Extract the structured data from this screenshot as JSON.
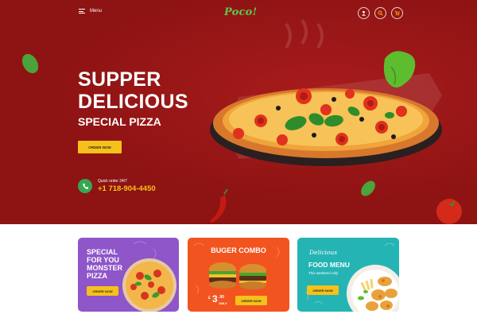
{
  "header": {
    "menu_label": "Menu",
    "logo": "Poco!",
    "icons": [
      "user-icon",
      "search-icon",
      "cart-icon"
    ]
  },
  "hero": {
    "headline_line1": "SUPPER",
    "headline_line2": "DELICIOUS",
    "subheadline": "SPECIAL PIZZA",
    "order_button": "ORDER NOW",
    "quick_order_label": "Quick order 24/7",
    "phone": "+1 718-904-4450",
    "icons": [
      "phone-icon",
      "pizza-image",
      "basil-leaf-icon",
      "tomato-icon",
      "chili-pepper-icon"
    ]
  },
  "promo_cards": [
    {
      "lines": [
        "SPECIAL",
        "FOR YOU",
        "MONSTER",
        "PIZZA"
      ],
      "button": "ORDER NOW",
      "background": "#8e56c9"
    },
    {
      "title": "BUGER COMBO",
      "price_currency": "£",
      "price_int": "3",
      "price_dec": ".90",
      "price_note": "ONLY",
      "button": "ORDER NOW",
      "background": "#f2541f"
    },
    {
      "script_label": "Delicious",
      "title": "FOOD MENU",
      "subtitle": "This weekend only",
      "button": "ORDER NOW",
      "background": "#25b4b4"
    }
  ],
  "colors": {
    "hero_red": "#8e1313",
    "accent_yellow": "#f6c11a",
    "logo_green": "#59c94c",
    "phone_green": "#34a853"
  }
}
